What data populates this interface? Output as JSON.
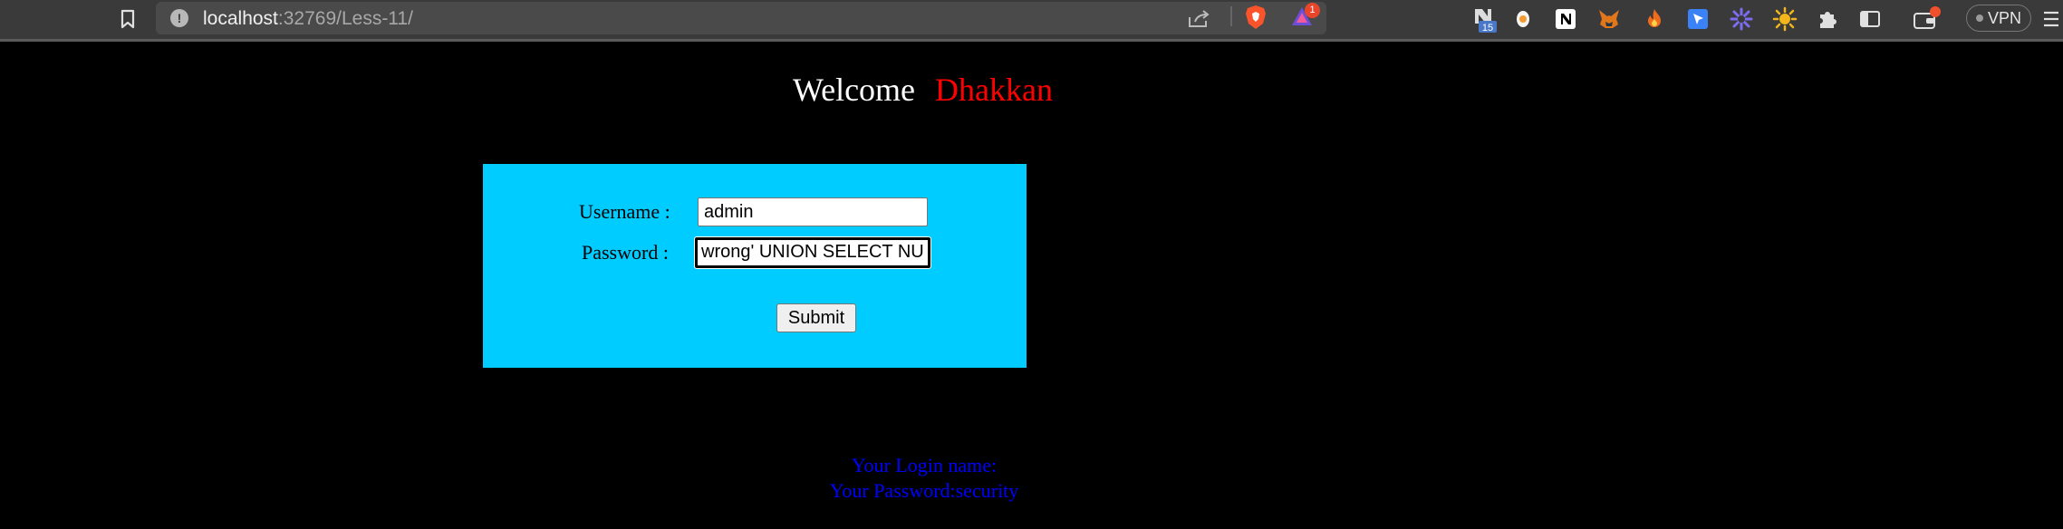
{
  "browser": {
    "url_host": "localhost",
    "url_path": ":32769/Less-11/",
    "rewards_badge": "1",
    "extension_badge": "15",
    "vpn_label": "VPN"
  },
  "page": {
    "welcome_word": "Welcome",
    "welcome_name": "Dhakkan",
    "form": {
      "username_label": "Username :",
      "password_label": "Password :",
      "username_value": "admin",
      "password_value": "wrong' UNION SELECT NU",
      "submit_label": "Submit"
    },
    "result": {
      "login_line": "Your Login name:",
      "password_line": "Your Password:security"
    }
  },
  "colors": {
    "background": "#000000",
    "form_bg": "#00ccff",
    "name_color": "#ff0000",
    "result_color": "#0000ff"
  }
}
